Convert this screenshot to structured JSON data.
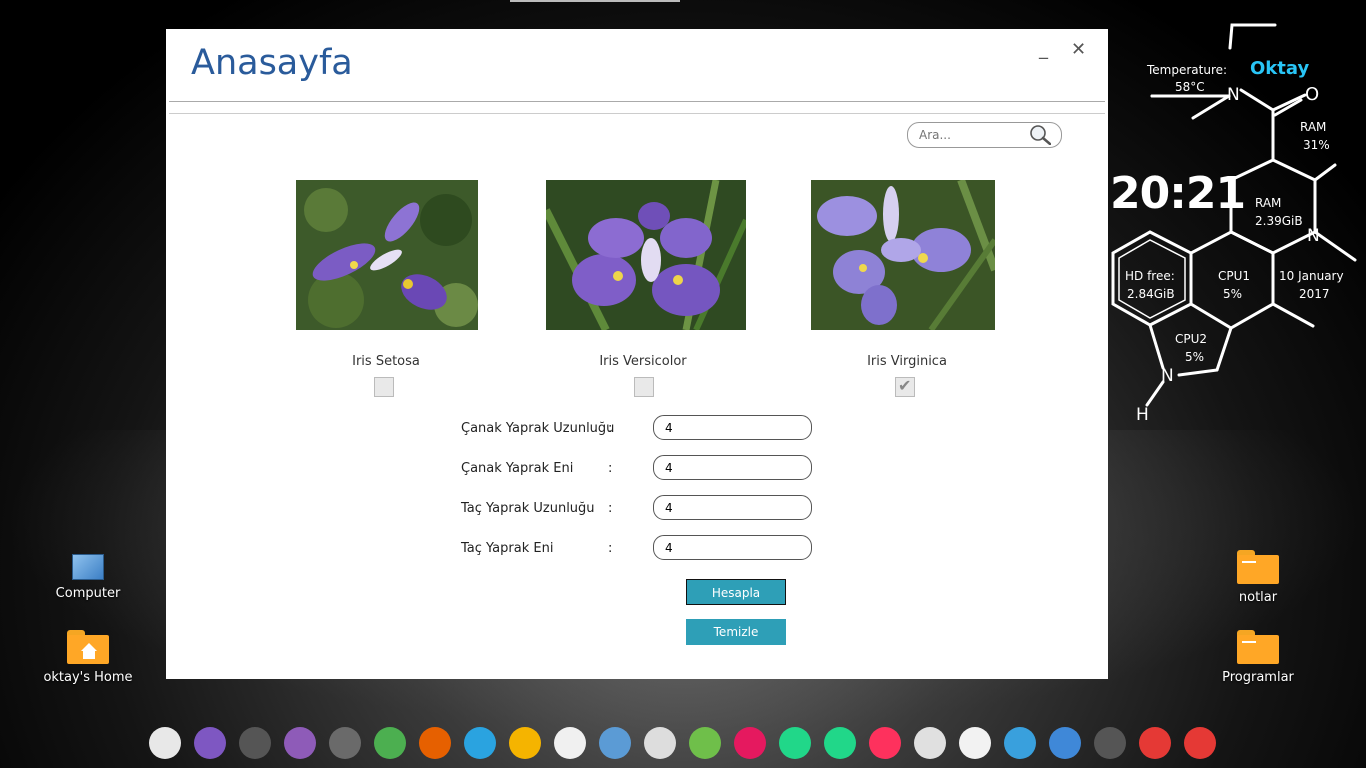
{
  "window": {
    "title": "Anasayfa",
    "minimize_glyph": "_",
    "close_glyph": "✕",
    "search": {
      "placeholder": "Ara...",
      "icon": "search-icon"
    }
  },
  "flowers": [
    {
      "name": "Iris Setosa",
      "checked": false
    },
    {
      "name": "Iris Versicolor",
      "checked": false
    },
    {
      "name": "Iris Virginica",
      "checked": true
    }
  ],
  "form": {
    "fields": [
      {
        "label": "Çanak Yaprak Uzunluğu",
        "value": "4"
      },
      {
        "label": "Çanak Yaprak Eni",
        "value": "4"
      },
      {
        "label": "Taç Yaprak Uzunluğu",
        "value": "4"
      },
      {
        "label": "Taç Yaprak Eni",
        "value": "4"
      }
    ],
    "colon": ":",
    "calculate_label": "Hesapla",
    "clear_label": "Temizle"
  },
  "desktop": {
    "left_icons": [
      {
        "label": "Computer"
      },
      {
        "label": "oktay's Home"
      }
    ],
    "right_icons": [
      {
        "label": "notlar"
      },
      {
        "label": "Programlar"
      }
    ]
  },
  "widget": {
    "temperature_label": "Temperature:",
    "temperature_value": "58°C",
    "user": "Oktay",
    "ram_percent_label": "RAM",
    "ram_percent": "31%",
    "clock": "20:21",
    "ram_used_label": "RAM",
    "ram_used": "2.39GiB",
    "hd_free_label": "HD free:",
    "hd_free": "2.84GiB",
    "cpu1_label": "CPU1",
    "cpu1": "5%",
    "cpu2_label": "CPU2",
    "cpu2": "5%",
    "date_day": "10 January",
    "date_year": "2017",
    "atom_n": "N",
    "atom_o": "O",
    "atom_h": "H"
  },
  "dock": [
    {
      "icon": "settings-toggle-icon",
      "color": "#e8e8e8"
    },
    {
      "icon": "files-icon",
      "color": "#7e57c2"
    },
    {
      "icon": "terminal-icon",
      "color": "#555555"
    },
    {
      "icon": "text-editor-icon",
      "color": "#8e5bb8"
    },
    {
      "icon": "sublime-icon",
      "color": "#6a6a6a"
    },
    {
      "icon": "chrome-icon",
      "color": "#4caf50"
    },
    {
      "icon": "firefox-icon",
      "color": "#e66000"
    },
    {
      "icon": "telegram-icon",
      "color": "#2aa3e0"
    },
    {
      "icon": "media-player-icon",
      "color": "#f5b400"
    },
    {
      "icon": "eclipse-icon",
      "color": "#f0f0f0"
    },
    {
      "icon": "virtualbox-icon",
      "color": "#5b9bd5"
    },
    {
      "icon": "gesture-icon",
      "color": "#dddddd"
    },
    {
      "icon": "android-studio-icon",
      "color": "#6fbf4a"
    },
    {
      "icon": "flickr-icon",
      "color": "#e5195f"
    },
    {
      "icon": "pycharm-icon",
      "color": "#21d789"
    },
    {
      "icon": "pycharm-ce-icon",
      "color": "#21d789"
    },
    {
      "icon": "intellij-icon",
      "color": "#fe315d"
    },
    {
      "icon": "postgresql-icon",
      "color": "#e0e0e0"
    },
    {
      "icon": "ghost-icon",
      "color": "#f2f2f2"
    },
    {
      "icon": "calculator-icon",
      "color": "#39a0dd"
    },
    {
      "icon": "document-viewer-icon",
      "color": "#3f88d8"
    },
    {
      "icon": "screenshot-icon",
      "color": "#555555"
    },
    {
      "icon": "trash-icon",
      "color": "#e53935"
    },
    {
      "icon": "app-grid-icon",
      "color": "#e53935"
    }
  ]
}
